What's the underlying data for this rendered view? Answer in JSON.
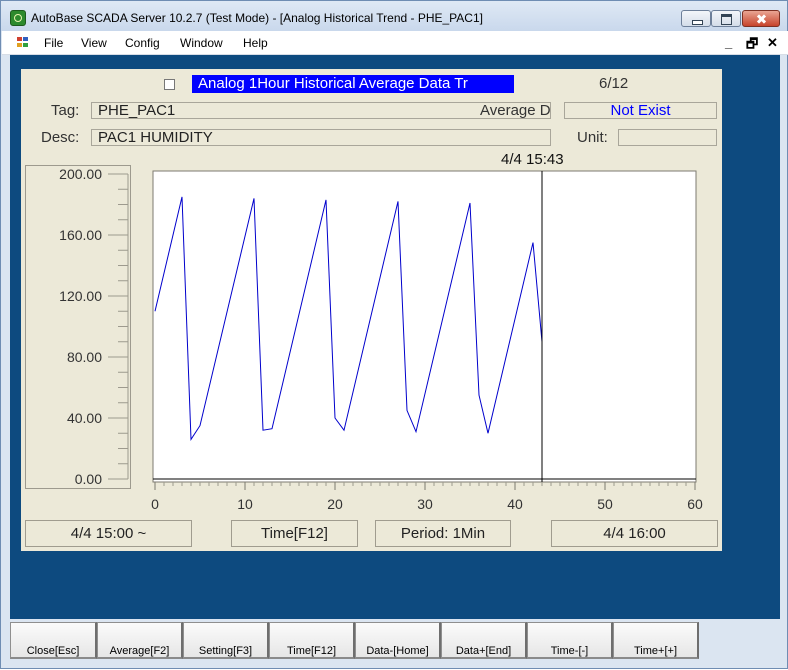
{
  "window": {
    "title": "AutoBase SCADA Server 10.2.7 (Test Mode) - [Analog Historical Trend - PHE_PAC1]"
  },
  "menu": {
    "items": [
      "File",
      "View",
      "Config",
      "Window",
      "Help"
    ],
    "mdi_restore": "🗗",
    "mdi_close": "✕"
  },
  "trend": {
    "mode_label": "Analog  1Hour  Historical  Average  Data  Tr",
    "page": "6/12",
    "tag_label": "Tag:",
    "tag_value": "PHE_PAC1",
    "average_label": "Average D",
    "average_value": "Not Exist",
    "desc_label": "Desc:",
    "desc_value": "PAC1 HUMIDITY",
    "unit_label": "Unit:",
    "unit_value": "",
    "cursor_time": "4/4 15:43",
    "start_button": "4/4 15:00 ~",
    "time_button": "Time[F12]",
    "period_button": "Period: 1Min",
    "end_button": "4/4 16:00",
    "colors": {
      "line": "#0000cc",
      "cursor": "#000000",
      "title_band": "#0000ff",
      "average_value": "#0000ff"
    }
  },
  "chart_data": {
    "type": "line",
    "xlim": [
      0,
      60
    ],
    "ylim": [
      0,
      200
    ],
    "x_ticks": [
      "0",
      "10",
      "20",
      "30",
      "40",
      "50",
      "60"
    ],
    "y_ticks": [
      "200.00",
      "160.00",
      "120.00",
      "80.00",
      "40.00",
      "0.00"
    ],
    "cursor_x": 43,
    "series": [
      {
        "x": [
          0,
          3,
          4,
          5,
          11,
          12,
          13,
          19,
          20,
          21,
          27,
          28,
          29,
          35,
          36,
          37,
          42,
          43,
          43
        ],
        "y": [
          110,
          185,
          26,
          35,
          184,
          32,
          33,
          183,
          40,
          32,
          182,
          45,
          31,
          181,
          55,
          30,
          155,
          90,
          7
        ]
      }
    ]
  },
  "function_keys": [
    "Close[Esc]",
    "Average[F2]",
    "Setting[F3]",
    "Time[F12]",
    "Data-[Home]",
    "Data+[End]",
    "Time-[-]",
    "Time+[+]"
  ]
}
